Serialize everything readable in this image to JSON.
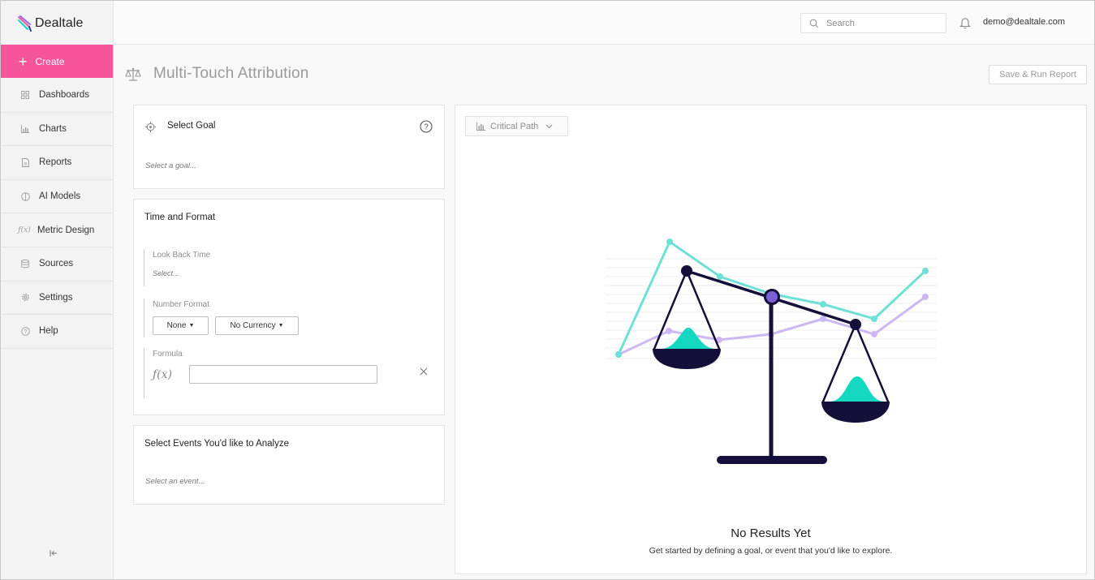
{
  "app": {
    "brand": "Dealtale",
    "colors": {
      "accent": "#f7559a",
      "teal": "#15d8c1",
      "navy": "#14103a",
      "lavender": "#c8b6f0"
    }
  },
  "sidebar": {
    "create_label": "Create",
    "items": [
      {
        "label": "Dashboards",
        "icon": "grid-icon"
      },
      {
        "label": "Charts",
        "icon": "bar-chart-icon"
      },
      {
        "label": "Reports",
        "icon": "document-icon"
      },
      {
        "label": "AI Models",
        "icon": "brain-icon"
      },
      {
        "label": "Metric Design",
        "icon": "function-icon"
      },
      {
        "label": "Sources",
        "icon": "database-icon"
      },
      {
        "label": "Settings",
        "icon": "gear-icon"
      },
      {
        "label": "Help",
        "icon": "help-icon"
      }
    ]
  },
  "topbar": {
    "search_placeholder": "Search",
    "user_email": "demo@dealtale.com"
  },
  "page": {
    "title": "Multi-Touch Attribution",
    "save_run_label": "Save & Run Report"
  },
  "goal_card": {
    "title": "Select Goal",
    "placeholder": "Select a goal..."
  },
  "time_card": {
    "title": "Time and Format",
    "look_back_label": "Look Back Time",
    "look_back_placeholder": "Select...",
    "number_format_label": "Number Format",
    "number_format_value": "None",
    "currency_value": "No Currency",
    "formula_label": "Formula",
    "formula_value": ""
  },
  "events_card": {
    "title": "Select Events You'd like to Analyze",
    "placeholder": "Select an event..."
  },
  "results": {
    "view_selector": "Critical Path",
    "empty_title": "No Results Yet",
    "empty_subtitle": "Get started by defining a goal, or event that you'd like to explore."
  }
}
